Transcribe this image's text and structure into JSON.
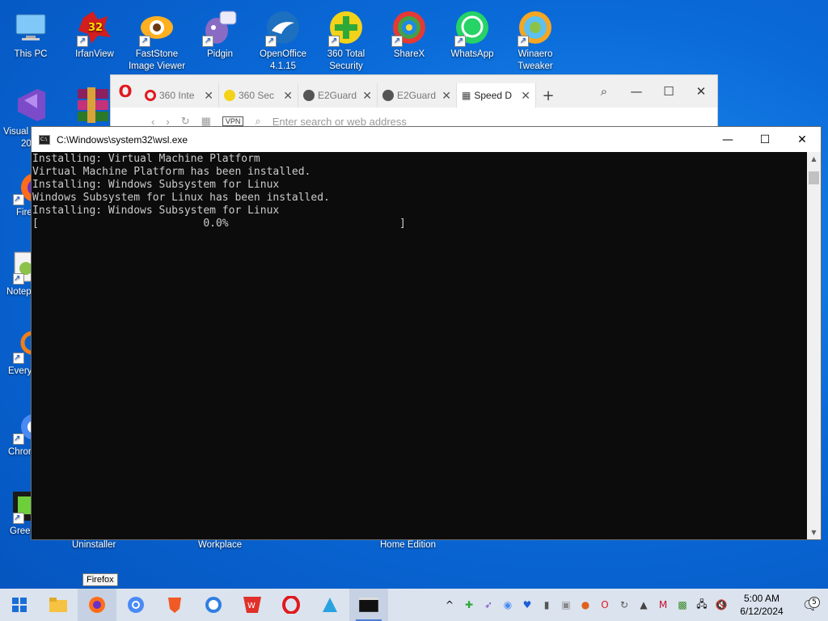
{
  "desktop": {
    "icons": [
      {
        "label": "This PC"
      },
      {
        "label": "IrfanView",
        "badge": "32"
      },
      {
        "label": "FastStone\nImage Viewer"
      },
      {
        "label": "Pidgin"
      },
      {
        "label": "OpenOffice\n4.1.15"
      },
      {
        "label": "360 Total\nSecurity"
      },
      {
        "label": "ShareX"
      },
      {
        "label": "WhatsApp"
      },
      {
        "label": "Winaero\nTweaker"
      }
    ],
    "left_icons": [
      {
        "label": "Visual"
      },
      {
        "label": "20"
      },
      {
        "label": "Fire"
      },
      {
        "label": "Notep"
      },
      {
        "label": "Every"
      },
      {
        "label": "Chron"
      },
      {
        "label": "Green"
      }
    ],
    "bottom_labels": [
      "Uninstaller",
      "Workplace",
      "Home Edition"
    ]
  },
  "browser": {
    "tabs": [
      {
        "label": "360 Inte",
        "color": "#e0191e"
      },
      {
        "label": "360 Sec",
        "color": "#3ab54a"
      },
      {
        "label": "E2Guard",
        "color": "#555555"
      },
      {
        "label": "E2Guard",
        "color": "#555555"
      },
      {
        "label": "Speed D",
        "color": "#444444",
        "active": true
      }
    ],
    "vpn_label": "VPN",
    "url_placeholder": "Enter search or web address"
  },
  "console": {
    "title": "C:\\Windows\\system32\\wsl.exe",
    "lines": [
      "Installing: Virtual Machine Platform",
      "Virtual Machine Platform has been installed.",
      "Installing: Windows Subsystem for Linux",
      "Windows Subsystem for Linux has been installed.",
      "Installing: Windows Subsystem for Linux",
      "[                          0.0%                           ]"
    ]
  },
  "tooltip": "Firefox",
  "taskbar": {
    "apps": [
      "start-icon",
      "file-explorer-icon",
      "firefox-icon",
      "chrome-icon",
      "brave-icon",
      "browser-icon",
      "wps-icon",
      "opera-icon",
      "app-icon",
      "terminal-icon"
    ],
    "time": "5:00 AM",
    "date": "6/12/2024",
    "notification_count": "5"
  }
}
